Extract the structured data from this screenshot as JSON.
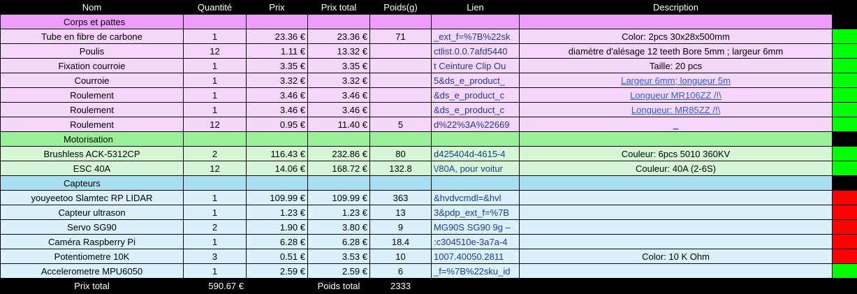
{
  "headers": [
    "Nom",
    "Quantité",
    "Prix",
    "Prix total",
    "Poids(g)",
    "Lien",
    "Description",
    ""
  ],
  "sections": [
    {
      "title": "Corps et pattes",
      "theme": "pink",
      "rows": [
        {
          "nom": "Tube en fibre de carbone",
          "qte": "1",
          "prix": "23.36 €",
          "total": "23.36 €",
          "poids": "71",
          "lien": "_ext_f=%7B%22sk",
          "desc": "Color: 2pcs 30x28x500mm",
          "desc_link": false,
          "status": "green"
        },
        {
          "nom": "Poulis",
          "qte": "12",
          "prix": "1.11 €",
          "total": "13.32 €",
          "poids": "",
          "lien": "ctlist.0.0.7afd5440",
          "desc": "diamètre d'alésage 12 teeth Bore 5mm ; largeur 6mm",
          "desc_link": false,
          "status": "green"
        },
        {
          "nom": "Fixation courroie",
          "qte": "1",
          "prix": "3.35 €",
          "total": "3.35 €",
          "poids": "",
          "lien": "t Ceinture Clip Ou",
          "desc": "Taille: 20 pcs",
          "desc_link": false,
          "status": "green"
        },
        {
          "nom": "Courroie",
          "qte": "1",
          "prix": "3.32 €",
          "total": "3.32 €",
          "poids": "",
          "lien": "5&ds_e_product_",
          "desc": "Largeur 6mm; longueur 5m",
          "desc_link": true,
          "status": "green"
        },
        {
          "nom": "Roulement",
          "qte": "1",
          "prix": "3.46 €",
          "total": "3.46 €",
          "poids": "",
          "lien": "&ds_e_product_c",
          "desc": "Longueur MR106ZZ /!\\",
          "desc_link": true,
          "status": "green"
        },
        {
          "nom": "Roulement",
          "qte": "1",
          "prix": "3.46 €",
          "total": "3.46 €",
          "poids": "",
          "lien": "&ds_e_product_c",
          "desc": "Longueur: MR85ZZ /!\\",
          "desc_link": true,
          "status": "green"
        },
        {
          "nom": "Roulement",
          "qte": "12",
          "prix": "0.95 €",
          "total": "11.40 €",
          "poids": "5",
          "lien": "d%22%3A%22669",
          "desc": "_",
          "desc_link": true,
          "status": "green"
        }
      ]
    },
    {
      "title": "Motorisation",
      "theme": "green",
      "rows": [
        {
          "nom": "Brushless ACK-5312CP",
          "qte": "2",
          "prix": "116.43 €",
          "total": "232.86 €",
          "poids": "80",
          "lien": "d425404d-4615-4",
          "desc": "Couleur: 6pcs 5010 360KV",
          "desc_link": false,
          "status": "green"
        },
        {
          "nom": "ESC 40A",
          "qte": "12",
          "prix": "14.06 €",
          "total": "168.72 €",
          "poids": "132.8",
          "lien": "\\/80A, pour voitur",
          "desc": "Couleur: 40A (2-6S)",
          "desc_link": false,
          "status": "green"
        }
      ]
    },
    {
      "title": "Capteurs",
      "theme": "blue",
      "rows": [
        {
          "nom": "youyeetoo Slamtec RP LIDAR",
          "qte": "1",
          "prix": "109.99 €",
          "total": "109.99 €",
          "poids": "363",
          "lien": "&hvdvcmdl=&hvl",
          "desc": "",
          "desc_link": false,
          "status": "red"
        },
        {
          "nom": "Capteur ultrason",
          "qte": "1",
          "prix": "1.23 €",
          "total": "1.23 €",
          "poids": "13",
          "lien": "3&pdp_ext_f=%7B",
          "desc": "",
          "desc_link": false,
          "status": "red"
        },
        {
          "nom": "Servo SG90",
          "qte": "2",
          "prix": "1.90 €",
          "total": "3.80 €",
          "poids": "9",
          "lien": "MG90S SG90 9g –",
          "desc": "",
          "desc_link": false,
          "status": "red"
        },
        {
          "nom": "Caméra Raspberry Pi",
          "qte": "1",
          "prix": "6.28 €",
          "total": "6.28 €",
          "poids": "18.4",
          "lien": ":c304510e-3a7a-4",
          "desc": "",
          "desc_link": false,
          "status": "red"
        },
        {
          "nom": "Potentiometre 10K",
          "qte": "3",
          "prix": "0.51 €",
          "total": "3.53 €",
          "poids": "10",
          "lien": "1007.40050.2811",
          "desc": "Color: 10 K Ohm",
          "desc_link": false,
          "status": "red"
        },
        {
          "nom": "Accelerometre MPU6050",
          "qte": "1",
          "prix": "2.59 €",
          "total": "2.59 €",
          "poids": "6",
          "lien": "_f=%7B%22sku_id",
          "desc": "",
          "desc_link": false,
          "status": "green"
        }
      ]
    }
  ],
  "totals": {
    "prix_label": "Prix total",
    "prix_value": "590.67 €",
    "poids_label": "Poids total",
    "poids_value": "2333"
  },
  "colors": {
    "status_green": "#00ff00",
    "status_red": "#ff0000"
  }
}
